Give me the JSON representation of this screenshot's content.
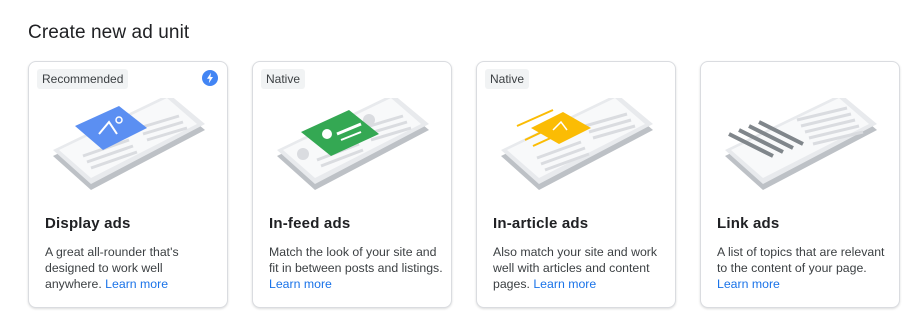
{
  "page": {
    "title": "Create new ad unit"
  },
  "cards": [
    {
      "badge": "Recommended",
      "has_bolt": true,
      "title": "Display ads",
      "desc": "A great all-rounder that's designed to work well anywhere.",
      "learn_more": "Learn more",
      "accent": "#5b8ff2"
    },
    {
      "badge": "Native",
      "title": "In-feed ads",
      "desc": "Match the look of your site and fit in between posts and listings.",
      "learn_more": "Learn more",
      "accent": "#34a853"
    },
    {
      "badge": "Native",
      "title": "In-article ads",
      "desc": "Also match your site and work well with articles and content pages.",
      "learn_more": "Learn more",
      "accent": "#fbbc04"
    },
    {
      "title": "Link ads",
      "desc": "A list of topics that are relevant to the content of your page.",
      "learn_more": "Learn more",
      "accent": "#9aa0a6"
    }
  ],
  "icons": {
    "bolt": "lightning-bolt-icon"
  }
}
